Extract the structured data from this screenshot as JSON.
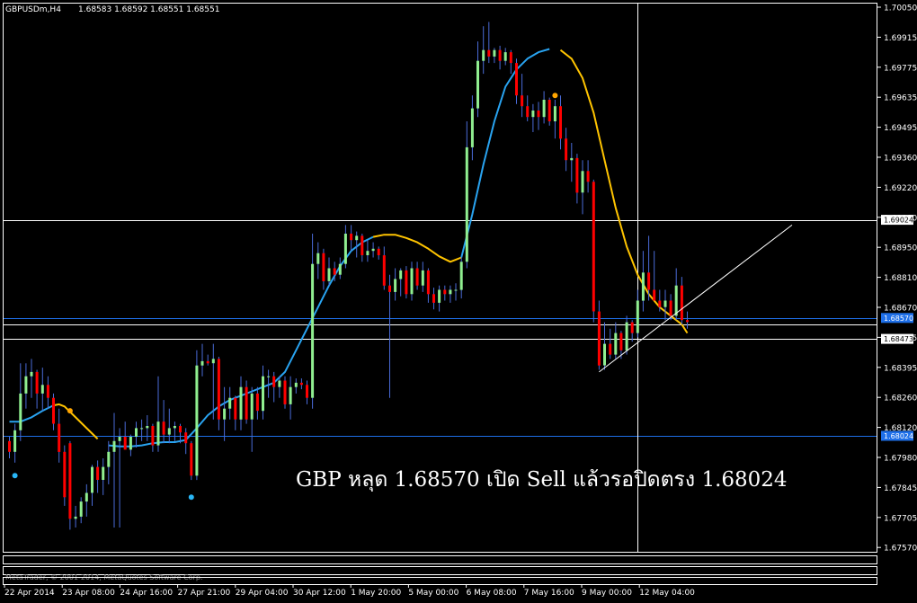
{
  "header": {
    "symbol_label": "GBPUSDm,H4",
    "ohlc_values": "1.68583 1.68592 1.68551 1.68551"
  },
  "copyright": "MetaTrader, © 2001-2014, MetaQuotes Software Corp.",
  "annotation": "GBP หลุด 1.68570  เปิด Sell  แล้วรอปิดตรง 1.68024",
  "colors": {
    "background": "#000000",
    "frame": "#ffffff",
    "bull_candle": "#90ee90",
    "bear_candle": "#ff0000",
    "wick": "#4a6bd8",
    "ma_up": "#29a3f0",
    "ma_down": "#ffc400",
    "hline_white": "#ffffff",
    "hline_blue": "#1e6fe8",
    "dot_blue": "#29b6f6",
    "dot_orange": "#ffa500"
  },
  "chart_data": {
    "type": "candlestick",
    "symbol": "GBPUSDm",
    "timeframe": "H4",
    "ylim": [
      1.675,
      1.7
    ],
    "y_ticks": [
      "1.70050",
      "1.69915",
      "1.69775",
      "1.69635",
      "1.69495",
      "1.69360",
      "1.69220",
      "1.69080",
      "1.68950",
      "1.68810",
      "1.68670",
      "1.68535",
      "1.68395",
      "1.68260",
      "1.68120",
      "1.67980",
      "1.67845",
      "1.67705",
      "1.67570"
    ],
    "x_ticks": [
      "22 Apr 2014",
      "23 Apr 08:00",
      "24 Apr 16:00",
      "27 Apr 21:00",
      "29 Apr 04:00",
      "30 Apr 12:00",
      "1 May 20:00",
      "5 May 00:00",
      "6 May 08:00",
      "7 May 16:00",
      "9 May 00:00",
      "12 May 04:00"
    ],
    "price_tags": [
      {
        "label": "1.69024",
        "value": 1.69024,
        "style": "white"
      },
      {
        "label": "1.68570",
        "value": 1.6857,
        "style": "blue"
      },
      {
        "label": "1.68473",
        "value": 1.68473,
        "style": "white"
      },
      {
        "label": "1.68024",
        "value": 1.68024,
        "style": "blue"
      }
    ],
    "horizontal_lines": [
      {
        "value": 1.69024,
        "color": "white"
      },
      {
        "value": 1.6857,
        "color": "blue"
      },
      {
        "value": 1.6854,
        "color": "white"
      },
      {
        "value": 1.68473,
        "color": "white"
      },
      {
        "value": 1.68024,
        "color": "blue"
      }
    ],
    "crosshair_bar": 114,
    "trendline": {
      "from_bar": 107,
      "from_price": 1.6832,
      "to_bar": 142,
      "to_price": 1.69
    },
    "ma_points": [
      [
        0,
        1.6809
      ],
      [
        2,
        1.6809
      ],
      [
        4,
        1.6811
      ],
      [
        6,
        1.6814
      ],
      [
        8,
        1.68165
      ],
      [
        9,
        1.6817
      ],
      [
        10,
        1.6816
      ],
      [
        12,
        1.6811
      ],
      [
        14,
        1.6806
      ],
      [
        16,
        1.6801
      ],
      [
        18,
        1.6798
      ],
      [
        20,
        1.67975
      ],
      [
        22,
        1.67975
      ],
      [
        24,
        1.6798
      ],
      [
        26,
        1.6799
      ],
      [
        28,
        1.67995
      ],
      [
        30,
        1.67995
      ],
      [
        32,
        1.68005
      ],
      [
        34,
        1.6806
      ],
      [
        36,
        1.6812
      ],
      [
        38,
        1.6816
      ],
      [
        40,
        1.6819
      ],
      [
        42,
        1.6821
      ],
      [
        44,
        1.6823
      ],
      [
        46,
        1.6825
      ],
      [
        48,
        1.6827
      ],
      [
        50,
        1.6832
      ],
      [
        52,
        1.6842
      ],
      [
        54,
        1.6852
      ],
      [
        56,
        1.6862
      ],
      [
        58,
        1.6872
      ],
      [
        60,
        1.6881
      ],
      [
        62,
        1.6888
      ],
      [
        64,
        1.6892
      ],
      [
        66,
        1.68945
      ],
      [
        68,
        1.68955
      ],
      [
        70,
        1.68955
      ],
      [
        72,
        1.6894
      ],
      [
        74,
        1.6892
      ],
      [
        76,
        1.6889
      ],
      [
        78,
        1.68855
      ],
      [
        80,
        1.6883
      ],
      [
        82,
        1.6885
      ],
      [
        84,
        1.6905
      ],
      [
        86,
        1.6928
      ],
      [
        88,
        1.6948
      ],
      [
        90,
        1.6964
      ],
      [
        92,
        1.6972
      ],
      [
        94,
        1.6977
      ],
      [
        96,
        1.698
      ],
      [
        98,
        1.69815
      ],
      [
        100,
        1.6981
      ],
      [
        102,
        1.6977
      ],
      [
        104,
        1.6968
      ],
      [
        106,
        1.6952
      ],
      [
        108,
        1.693
      ],
      [
        110,
        1.6908
      ],
      [
        112,
        1.689
      ],
      [
        114,
        1.6877
      ],
      [
        116,
        1.6868
      ],
      [
        118,
        1.6862
      ],
      [
        120,
        1.6858
      ],
      [
        122,
        1.6854
      ],
      [
        123,
        1.685
      ]
    ],
    "ma_segments": [
      {
        "from": 0,
        "to": 8,
        "color": "up"
      },
      {
        "from": 8,
        "to": 17,
        "color": "down"
      },
      {
        "from": 17,
        "to": 66,
        "color": "up"
      },
      {
        "from": 66,
        "to": 82,
        "color": "down"
      },
      {
        "from": 82,
        "to": 99,
        "color": "up"
      },
      {
        "from": 99,
        "to": 123,
        "color": "down"
      }
    ],
    "dots": [
      {
        "bar": 1,
        "price": 1.6784,
        "color": "blue"
      },
      {
        "bar": 11,
        "price": 1.6814,
        "color": "orange"
      },
      {
        "bar": 33,
        "price": 1.6774,
        "color": "blue"
      },
      {
        "bar": 99,
        "price": 1.696,
        "color": "orange"
      }
    ],
    "candles": [
      [
        1.68,
        1.6802,
        1.6792,
        1.6795
      ],
      [
        1.6795,
        1.6808,
        1.679,
        1.6805
      ],
      [
        1.6805,
        1.6836,
        1.68,
        1.6822
      ],
      [
        1.6822,
        1.6836,
        1.6815,
        1.683
      ],
      [
        1.683,
        1.6838,
        1.682,
        1.6832
      ],
      [
        1.6832,
        1.6833,
        1.6815,
        1.6822
      ],
      [
        1.6822,
        1.6834,
        1.6814,
        1.6826
      ],
      [
        1.6826,
        1.683,
        1.6815,
        1.682
      ],
      [
        1.682,
        1.6822,
        1.6805,
        1.6808
      ],
      [
        1.6808,
        1.6815,
        1.679,
        1.6795
      ],
      [
        1.6795,
        1.6798,
        1.677,
        1.6774
      ],
      [
        1.6799,
        1.68,
        1.6759,
        1.6764
      ],
      [
        1.6764,
        1.677,
        1.676,
        1.6765
      ],
      [
        1.6765,
        1.6774,
        1.6762,
        1.6772
      ],
      [
        1.6772,
        1.678,
        1.6765,
        1.6776
      ],
      [
        1.6776,
        1.6789,
        1.677,
        1.6788
      ],
      [
        1.6788,
        1.6791,
        1.6776,
        1.6782
      ],
      [
        1.6782,
        1.6792,
        1.6775,
        1.6788
      ],
      [
        1.6788,
        1.68,
        1.678,
        1.6795
      ],
      [
        1.6795,
        1.6813,
        1.676,
        1.68
      ],
      [
        1.68,
        1.6806,
        1.676,
        1.6802
      ],
      [
        1.6802,
        1.6809,
        1.6797,
        1.6796
      ],
      [
        1.6796,
        1.6803,
        1.6793,
        1.6802
      ],
      [
        1.6802,
        1.6809,
        1.6797,
        1.6806
      ],
      [
        1.6806,
        1.681,
        1.68,
        1.6806
      ],
      [
        1.6806,
        1.6812,
        1.68,
        1.6807
      ],
      [
        1.6807,
        1.6808,
        1.6795,
        1.6798
      ],
      [
        1.6798,
        1.683,
        1.6795,
        1.6809
      ],
      [
        1.6809,
        1.6819,
        1.6799,
        1.6803
      ],
      [
        1.6803,
        1.6815,
        1.6799,
        1.6806
      ],
      [
        1.6806,
        1.6809,
        1.68,
        1.6807
      ],
      [
        1.6807,
        1.6808,
        1.6799,
        1.6804
      ],
      [
        1.6804,
        1.6806,
        1.6794,
        1.6799
      ],
      [
        1.6799,
        1.68,
        1.6782,
        1.6784
      ],
      [
        1.6784,
        1.6842,
        1.6782,
        1.6835
      ],
      [
        1.6835,
        1.6845,
        1.683,
        1.6837
      ],
      [
        1.6837,
        1.684,
        1.6835,
        1.6836
      ],
      [
        1.6836,
        1.6845,
        1.681,
        1.6838
      ],
      [
        1.6838,
        1.6839,
        1.6805,
        1.681
      ],
      [
        1.681,
        1.6825,
        1.68,
        1.6815
      ],
      [
        1.6815,
        1.6825,
        1.681,
        1.682
      ],
      [
        1.682,
        1.6821,
        1.6805,
        1.681
      ],
      [
        1.681,
        1.683,
        1.6805,
        1.6825
      ],
      [
        1.6825,
        1.6828,
        1.6808,
        1.681
      ],
      [
        1.681,
        1.6825,
        1.6795,
        1.6822
      ],
      [
        1.6822,
        1.6825,
        1.681,
        1.6814
      ],
      [
        1.6814,
        1.6835,
        1.681,
        1.683
      ],
      [
        1.683,
        1.6833,
        1.682,
        1.683
      ],
      [
        1.683,
        1.6832,
        1.6818,
        1.6825
      ],
      [
        1.6825,
        1.683,
        1.682,
        1.6828
      ],
      [
        1.6828,
        1.683,
        1.6815,
        1.6817
      ],
      [
        1.6817,
        1.683,
        1.681,
        1.6825
      ],
      [
        1.6825,
        1.6829,
        1.6822,
        1.6827
      ],
      [
        1.6827,
        1.6829,
        1.6824,
        1.6826
      ],
      [
        1.6826,
        1.6828,
        1.6817,
        1.682
      ],
      [
        1.682,
        1.6896,
        1.6815,
        1.6882
      ],
      [
        1.6882,
        1.6892,
        1.6875,
        1.6887
      ],
      [
        1.6887,
        1.6889,
        1.687,
        1.6874
      ],
      [
        1.6874,
        1.6885,
        1.6872,
        1.688
      ],
      [
        1.688,
        1.6883,
        1.6874,
        1.6877
      ],
      [
        1.6877,
        1.6885,
        1.6875,
        1.6882
      ],
      [
        1.6882,
        1.69,
        1.688,
        1.6896
      ],
      [
        1.6896,
        1.69,
        1.6888,
        1.6893
      ],
      [
        1.6893,
        1.6897,
        1.6885,
        1.6895
      ],
      [
        1.6895,
        1.6896,
        1.6883,
        1.6886
      ],
      [
        1.6886,
        1.6893,
        1.6883,
        1.6888
      ],
      [
        1.6888,
        1.6892,
        1.6885,
        1.6889
      ],
      [
        1.6889,
        1.689,
        1.6884,
        1.6886
      ],
      [
        1.6886,
        1.689,
        1.687,
        1.6872
      ],
      [
        1.6872,
        1.6877,
        1.682,
        1.6869
      ],
      [
        1.6869,
        1.688,
        1.6865,
        1.6875
      ],
      [
        1.6875,
        1.688,
        1.6867,
        1.6879
      ],
      [
        1.6879,
        1.6881,
        1.6866,
        1.6868
      ],
      [
        1.6868,
        1.6883,
        1.6865,
        1.688
      ],
      [
        1.688,
        1.6883,
        1.687,
        1.6872
      ],
      [
        1.6872,
        1.6883,
        1.6869,
        1.6879
      ],
      [
        1.6879,
        1.688,
        1.6864,
        1.6868
      ],
      [
        1.6868,
        1.6871,
        1.6861,
        1.6864
      ],
      [
        1.6864,
        1.6872,
        1.686,
        1.687
      ],
      [
        1.687,
        1.6872,
        1.6865,
        1.6868
      ],
      [
        1.6868,
        1.6872,
        1.6864,
        1.687
      ],
      [
        1.687,
        1.6873,
        1.6865,
        1.687
      ],
      [
        1.687,
        1.6885,
        1.6866,
        1.6883
      ],
      [
        1.6883,
        1.6948,
        1.688,
        1.6936
      ],
      [
        1.6936,
        1.696,
        1.693,
        1.6954
      ],
      [
        1.6954,
        1.6985,
        1.695,
        1.6976
      ],
      [
        1.6976,
        1.6992,
        1.697,
        1.6981
      ],
      [
        1.6981,
        1.6994,
        1.6975,
        1.6978
      ],
      [
        1.6978,
        1.6982,
        1.6975,
        1.6981
      ],
      [
        1.6981,
        1.6983,
        1.6972,
        1.6976
      ],
      [
        1.6976,
        1.6982,
        1.6974,
        1.698
      ],
      [
        1.698,
        1.6981,
        1.697,
        1.6975
      ],
      [
        1.6975,
        1.6977,
        1.6956,
        1.696
      ],
      [
        1.696,
        1.697,
        1.695,
        1.6955
      ],
      [
        1.6955,
        1.696,
        1.6948,
        1.695
      ],
      [
        1.695,
        1.6956,
        1.6943,
        1.6953
      ],
      [
        1.6953,
        1.6957,
        1.6944,
        1.695
      ],
      [
        1.695,
        1.6962,
        1.6947,
        1.6958
      ],
      [
        1.6958,
        1.6959,
        1.6946,
        1.6948
      ],
      [
        1.6948,
        1.6958,
        1.694,
        1.6955
      ],
      [
        1.6955,
        1.696,
        1.6935,
        1.694
      ],
      [
        1.694,
        1.6945,
        1.6925,
        1.693
      ],
      [
        1.693,
        1.6938,
        1.692,
        1.6931
      ],
      [
        1.6931,
        1.6933,
        1.691,
        1.6915
      ],
      [
        1.6915,
        1.693,
        1.6905,
        1.6925
      ],
      [
        1.6925,
        1.693,
        1.6915,
        1.692
      ],
      [
        1.692,
        1.6921,
        1.6855,
        1.686
      ],
      [
        1.686,
        1.6865,
        1.6833,
        1.6835
      ],
      [
        1.6835,
        1.6855,
        1.6833,
        1.6845
      ],
      [
        1.6845,
        1.6852,
        1.6838,
        1.684
      ],
      [
        1.684,
        1.6855,
        1.6838,
        1.685
      ],
      [
        1.685,
        1.6851,
        1.6838,
        1.6842
      ],
      [
        1.6842,
        1.6858,
        1.684,
        1.6855
      ],
      [
        1.6855,
        1.6856,
        1.6846,
        1.685
      ],
      [
        1.685,
        1.687,
        1.6848,
        1.6865
      ],
      [
        1.6865,
        1.6888,
        1.686,
        1.6878
      ],
      [
        1.6878,
        1.6895,
        1.6865,
        1.687
      ],
      [
        1.687,
        1.6888,
        1.6865,
        1.6865
      ],
      [
        1.6865,
        1.687,
        1.686,
        1.6862
      ],
      [
        1.6862,
        1.687,
        1.6856,
        1.6865
      ],
      [
        1.6865,
        1.6868,
        1.6856,
        1.6858
      ],
      [
        1.6858,
        1.688,
        1.6856,
        1.6872
      ],
      [
        1.6872,
        1.6876,
        1.6854,
        1.6856
      ],
      [
        1.6856,
        1.686,
        1.6852,
        1.68551
      ]
    ]
  }
}
